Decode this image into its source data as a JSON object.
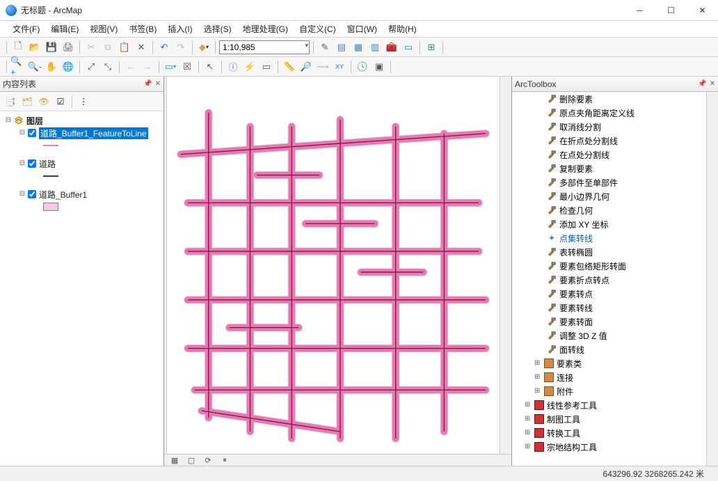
{
  "window": {
    "title": "无标题 - ArcMap"
  },
  "menu": {
    "file": "文件(F)",
    "edit": "编辑(E)",
    "view": "视图(V)",
    "bookmarks": "书签(B)",
    "insert": "插入(I)",
    "select": "选择(S)",
    "geoproc": "地理处理(G)",
    "customize": "自定义(C)",
    "window": "窗口(W)",
    "help": "帮助(H)"
  },
  "toolbar": {
    "scale": "1:10,985"
  },
  "toc": {
    "title": "内容列表",
    "root": "图层",
    "layer1": "道路_Buffer1_FeatureToLine",
    "layer2": "道路",
    "layer3": "道路_Buffer1"
  },
  "toolbox": {
    "title": "ArcToolbox",
    "tools": [
      "删除要素",
      "原点夹角距离定义线",
      "取消线分割",
      "在折点处分割线",
      "在点处分割线",
      "复制要素",
      "多部件至单部件",
      "最小边界几何",
      "检查几何",
      "添加 XY 坐标",
      "点集转线",
      "表转椭圆",
      "要素包络矩形转面",
      "要素折点转点",
      "要素转点",
      "要素转线",
      "要素转面",
      "调整 3D Z 值",
      "面转线"
    ],
    "highlight_index": 10,
    "groups": [
      "要素类",
      "连接",
      "附件"
    ],
    "redgroups": [
      "线性参考工具",
      "制图工具",
      "转换工具",
      "宗地结构工具"
    ]
  },
  "status": {
    "coords": "643296.92 3268265.242 米"
  }
}
